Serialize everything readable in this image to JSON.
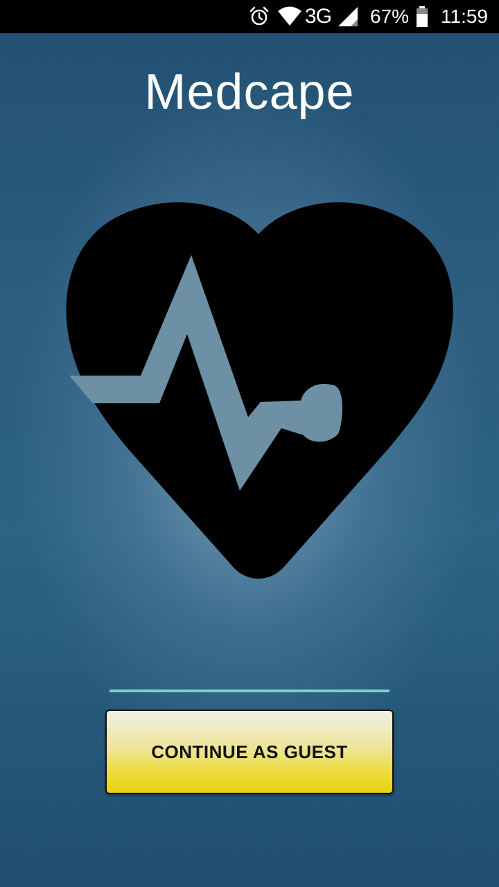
{
  "status_bar": {
    "network": "3G",
    "battery": "67%",
    "time": "11:59",
    "icons": [
      "alarm-icon",
      "wifi-icon",
      "signal-icon",
      "battery-icon"
    ]
  },
  "app": {
    "title": "Medcape",
    "logo_icon": "heart-pulse-icon"
  },
  "actions": {
    "continue_guest_label": "CONTINUE AS GUEST"
  },
  "colors": {
    "background": "#2a5c80",
    "divider": "#7fd1c8",
    "button_top": "#f1efe8",
    "button_bottom": "#e8d210"
  }
}
